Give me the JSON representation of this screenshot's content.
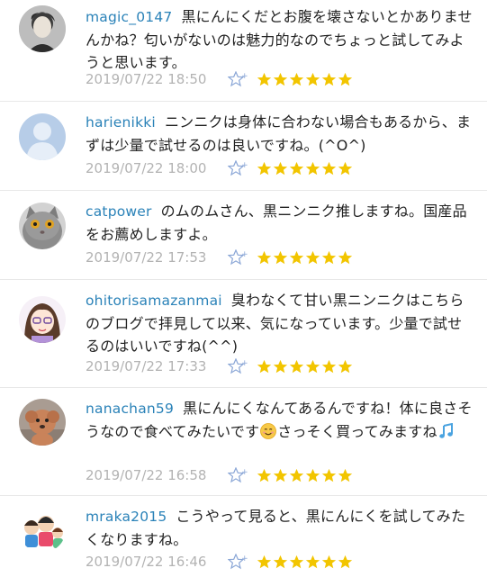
{
  "comments": [
    {
      "username": "magic_0147",
      "text": "黒にんにくだとお腹を壊さないとかありませんかね？匂いがないのは魅力的なのでちょっと試してみようと思います。",
      "date": "2019/07/22 18:50",
      "stars": 6,
      "avatar": "avatar-man-photo"
    },
    {
      "username": "harienikki",
      "text": "ニンニクは身体に合わない場合もあるから、まずは少量で試せるのは良いですね。(^O^)",
      "date": "2019/07/22 18:00",
      "stars": 6,
      "avatar": "avatar-default-silhouette"
    },
    {
      "username": "catpower",
      "text": "のムのムさん、黒ニンニク推しますね。国産品をお薦めしますよ。",
      "date": "2019/07/22 17:53",
      "stars": 6,
      "avatar": "avatar-cat-photo"
    },
    {
      "username": "ohitorisamazanmai",
      "text": "臭わなくて甘い黒ニンニクはこちらのブログで拝見して以来、気になっています。少量で試せるのはいいですね(^^)",
      "date": "2019/07/22 17:33",
      "stars": 6,
      "avatar": "avatar-girl-illustration"
    },
    {
      "username": "nanachan59",
      "text_before": "黒にんにくなんてあるんですね！体に良さそうなので食べてみたいです",
      "text_middle": "さっそく買ってみますね",
      "date": "2019/07/22 16:58",
      "stars": 6,
      "avatar": "avatar-dog-photo"
    },
    {
      "username": "mraka2015",
      "text": "こうやって見ると、黒にんにくを試してみたくなりますね。",
      "date": "2019/07/22 16:46",
      "stars": 6,
      "avatar": "avatar-family-illustration"
    }
  ],
  "colors": {
    "username": "#2a82b8",
    "date": "#b3b3b3",
    "star": "#f2c500",
    "star_plus_outline": "#8aa6d6",
    "divider": "#e8e8e8"
  }
}
